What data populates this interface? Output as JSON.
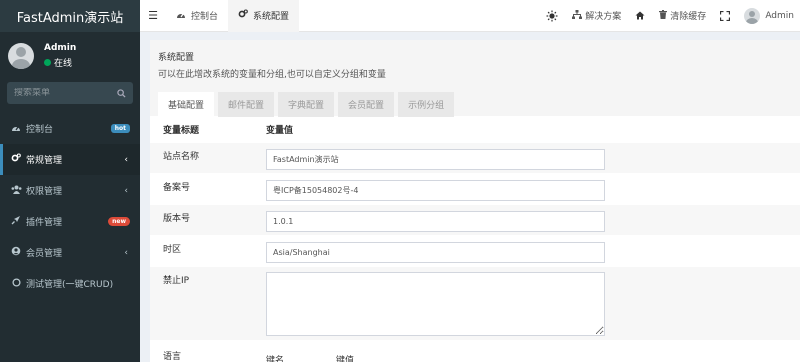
{
  "app": {
    "logo_text": "FastAdmin演示站"
  },
  "user": {
    "name": "Admin",
    "status": "在线"
  },
  "sidebar": {
    "search_placeholder": "搜索菜单",
    "items": [
      {
        "label": "控制台",
        "icon": "dashboard-icon",
        "badge": "hot",
        "badge_color": "#3c8dbc"
      },
      {
        "label": "常规管理",
        "icon": "cogs-icon",
        "chevron": "‹"
      },
      {
        "label": "权限管理",
        "icon": "group-icon",
        "chevron": "‹"
      },
      {
        "label": "插件管理",
        "icon": "rocket-icon",
        "badge": "new",
        "badge_color": "#dd4b39"
      },
      {
        "label": "会员管理",
        "icon": "user-circle-icon",
        "chevron": "‹"
      },
      {
        "label": "测试管理(一键CRUD)",
        "icon": "circle-o-icon"
      }
    ]
  },
  "header": {
    "tabs": [
      {
        "label": "控制台",
        "icon": "dashboard-icon"
      },
      {
        "label": "系统配置",
        "icon": "cogs-icon"
      }
    ],
    "solution_label": "解决方案",
    "clear_cache_label": "清除缓存",
    "user_label": "Admin"
  },
  "main": {
    "title": "系统配置",
    "description": "可以在此增改系统的变量和分组,也可以自定义分组和变量",
    "tabs": [
      "基础配置",
      "邮件配置",
      "字典配置",
      "会员配置",
      "示例分组"
    ],
    "table": {
      "header_title": "变量标题",
      "header_value": "变量值",
      "rows": [
        {
          "label": "站点名称",
          "value": "FastAdmin演示站"
        },
        {
          "label": "备案号",
          "value": "粤ICP备15054802号-4"
        },
        {
          "label": "版本号",
          "value": "1.0.1"
        },
        {
          "label": "时区",
          "value": "Asia/Shanghai"
        },
        {
          "label": "禁止IP",
          "value": ""
        },
        {
          "label": "语言",
          "key_header": "键名",
          "value_header": "键值"
        }
      ]
    }
  },
  "colors": {
    "sidebar_bg": "#222d32",
    "accent": "#3c8dbc",
    "online": "#00a65a",
    "new_badge": "#dd4b39"
  }
}
